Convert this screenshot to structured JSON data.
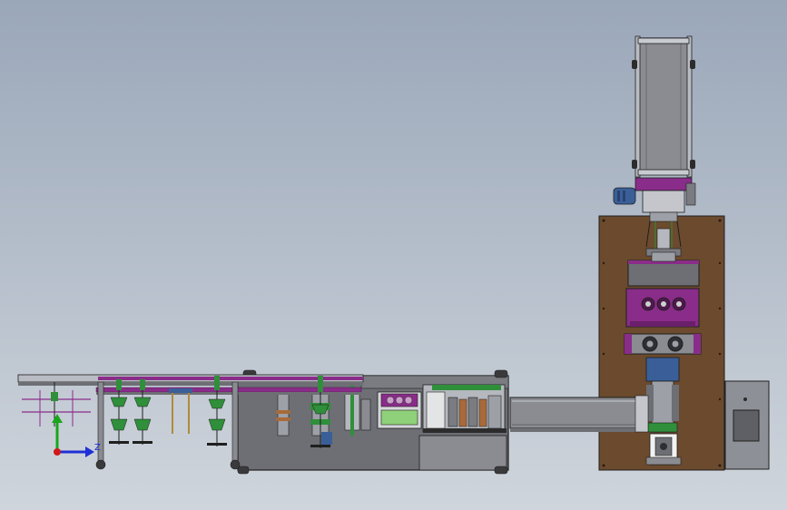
{
  "viewport": {
    "background_top": "#9aa7b9",
    "background_bottom": "#cfd5dc"
  },
  "triad": {
    "axis_labels": [
      "Z"
    ],
    "x_color": "#1f2fd6",
    "y_color": "#1aa51a",
    "origin_color": "#d01818"
  },
  "colors": {
    "frame": "#6b4a2e",
    "steel": "#6d6f74",
    "plate": "#8a8c92",
    "accent_purple": "#8a2c8a",
    "accent_green": "#2f8f3a",
    "motor_blue": "#3a5f98",
    "outline": "#1f1f1f"
  }
}
